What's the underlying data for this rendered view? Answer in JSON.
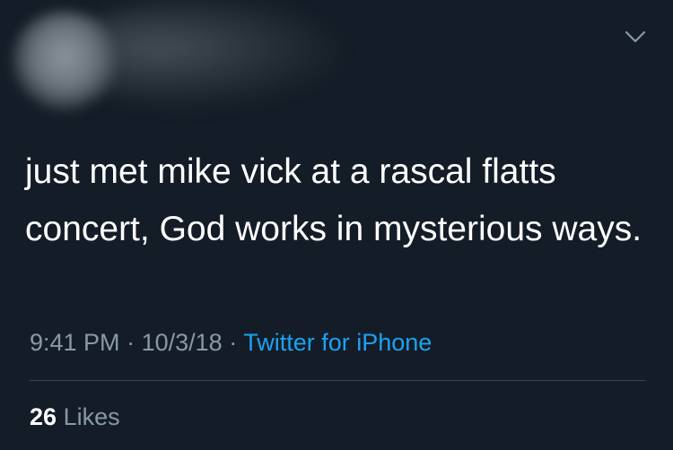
{
  "tweet": {
    "text": "just met mike vick at a rascal flatts concert, God works in mysterious ways.",
    "time": "9:41 PM",
    "separator": "·",
    "date": "10/3/18",
    "source": "Twitter for iPhone",
    "likes_count": "26",
    "likes_label": "Likes"
  },
  "icons": {
    "menu": "chevron-down-icon"
  },
  "colors": {
    "background": "#141d27",
    "text": "#ffffff",
    "secondary_text": "#8899a6",
    "link": "#1da1f2",
    "divider": "#38444d"
  }
}
